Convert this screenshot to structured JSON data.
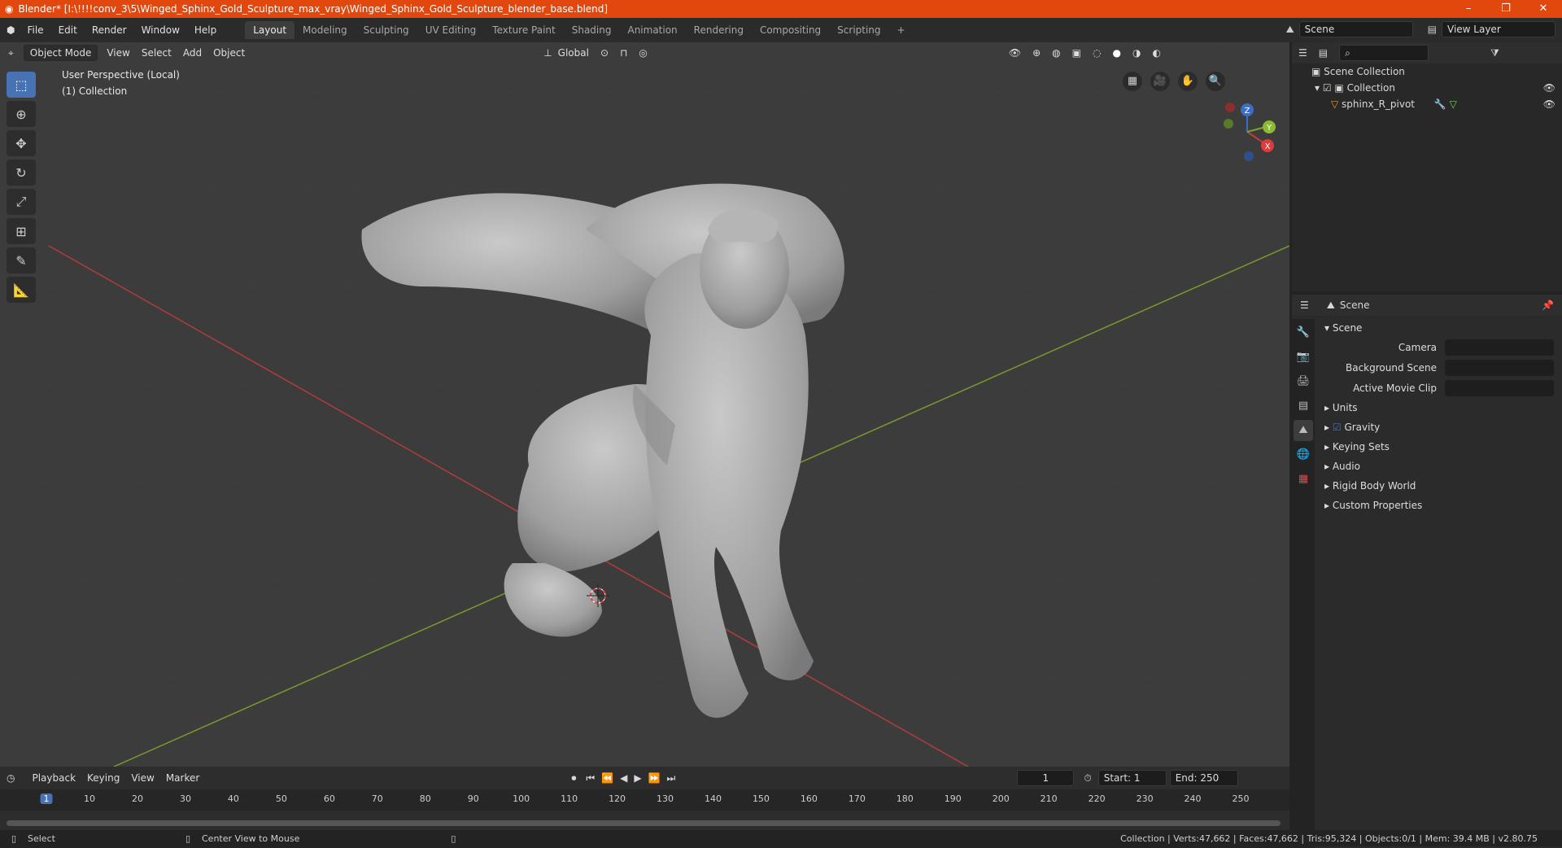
{
  "window": {
    "title": "Blender* [I:\\!!!!conv_3\\5\\Winged_Sphinx_Gold_Sculpture_max_vray\\Winged_Sphinx_Gold_Sculpture_blender_base.blend]",
    "minimize": "–",
    "maximize": "❐",
    "close": "✕"
  },
  "menubar": {
    "items": [
      "File",
      "Edit",
      "Render",
      "Window",
      "Help"
    ]
  },
  "workspaces": {
    "tabs": [
      "Layout",
      "Modeling",
      "Sculpting",
      "UV Editing",
      "Texture Paint",
      "Shading",
      "Animation",
      "Rendering",
      "Compositing",
      "Scripting"
    ],
    "active": "Layout",
    "add": "+"
  },
  "scene_selector": {
    "value": "Scene"
  },
  "view_layer": {
    "value": "View Layer"
  },
  "viewport": {
    "mode": "Object Mode",
    "menus": [
      "View",
      "Select",
      "Add",
      "Object"
    ],
    "transform_orientation": "Global",
    "info_line1": "User Perspective (Local)",
    "info_line2": "(1) Collection",
    "gizmo_axes": {
      "x": "X",
      "y": "Y",
      "z": "Z"
    }
  },
  "outliner": {
    "root": "Scene Collection",
    "collection": "Collection",
    "object": "sphinx_R_pivot"
  },
  "properties": {
    "header": "Scene",
    "panel": "Scene",
    "fields": [
      {
        "label": "Camera"
      },
      {
        "label": "Background Scene"
      },
      {
        "label": "Active Movie Clip"
      }
    ],
    "subpanels": [
      "Units",
      "Gravity",
      "Keying Sets",
      "Audio",
      "Rigid Body World",
      "Custom Properties"
    ],
    "gravity_checked": true
  },
  "timeline": {
    "menus": [
      "Playback",
      "Keying",
      "View",
      "Marker"
    ],
    "current_frame": "1",
    "start_label": "Start:",
    "start": "1",
    "end_label": "End:",
    "end": "250",
    "ticks": [
      "1",
      "10",
      "20",
      "30",
      "40",
      "50",
      "60",
      "70",
      "80",
      "90",
      "100",
      "110",
      "120",
      "130",
      "140",
      "150",
      "160",
      "170",
      "180",
      "190",
      "200",
      "210",
      "220",
      "230",
      "240",
      "250"
    ]
  },
  "statusbar": {
    "left": "Select",
    "middle": "Center View to Mouse",
    "right": "Collection | Verts:47,662 | Faces:47,662 | Tris:95,324 | Objects:0/1 | Mem: 39.4 MB | v2.80.75"
  },
  "colors": {
    "titlebar": "#e2470e",
    "viewport_bg": "#3c3c3c",
    "axis_x": "#b23c3c",
    "axis_y": "#7a9a2c",
    "accent": "#4772b3"
  }
}
